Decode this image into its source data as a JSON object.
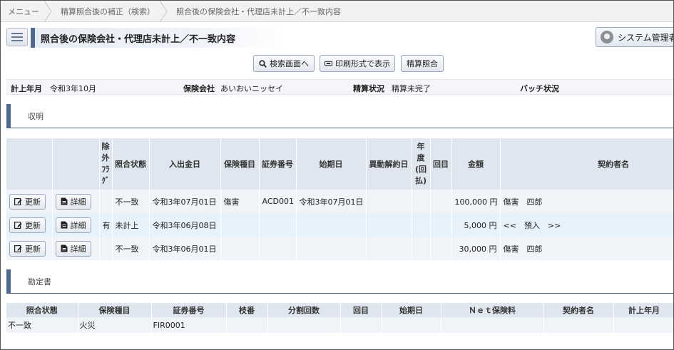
{
  "breadcrumb": [
    "メニュー",
    "精算照合後の補正（検索）",
    "照合後の保険会社・代理店未計上／不一致内容"
  ],
  "header": {
    "title": "照合後の保険会社・代理店未計上／不一致内容",
    "user_label": "システム管理者"
  },
  "toolbar": {
    "search_label": "検索画面へ",
    "print_label": "印刷形式で表示",
    "match_label": "精算照合"
  },
  "info": {
    "period_label": "計上年月",
    "period_value": "令和3年10月",
    "insurer_label": "保険会社",
    "insurer_value": "あいおいニッセイ",
    "status_label": "精算状況",
    "status_value": "精算未完了",
    "batch_label": "バッチ状況",
    "batch_value": ""
  },
  "sections": {
    "receipt": "収明",
    "account": "勘定書"
  },
  "main_table": {
    "headers": [
      "",
      "",
      "除外フラグ",
      "照合状態",
      "入出金日",
      "保険種目",
      "証券番号",
      "始期日",
      "異動解約日",
      "年度(回払)",
      "回目",
      "金額",
      "契約者名"
    ],
    "exclude_header_lines": [
      "除",
      "外",
      "ﾌﾗ",
      "ｸﾞ"
    ],
    "year_header_lines": [
      "年",
      "度",
      "(回",
      "払)"
    ],
    "update_label": "更新",
    "detail_label": "詳細",
    "rows": [
      {
        "exclude": "",
        "status": "不一致",
        "date": "令和3年07月01日",
        "type": "傷害",
        "policy": "ACD001",
        "start": "令和3年07月01日",
        "change": "",
        "year": "",
        "times": "",
        "amount": "100,000 円",
        "name": "傷害　四郎"
      },
      {
        "exclude": "有",
        "status": "未計上",
        "date": "令和3年06月08日",
        "type": "",
        "policy": "",
        "start": "",
        "change": "",
        "year": "",
        "times": "",
        "amount": "5,000 円",
        "name": "<<　預入　>>"
      },
      {
        "exclude": "",
        "status": "不一致",
        "date": "令和3年06月01日",
        "type": "",
        "policy": "",
        "start": "",
        "change": "",
        "year": "",
        "times": "",
        "amount": "30,000 円",
        "name": "傷害　四郎"
      }
    ]
  },
  "sub_table": {
    "headers": [
      "照合状態",
      "保険種目",
      "証券番号",
      "枝番",
      "分割回数",
      "回目",
      "始期日",
      "Ｎｅｔ保険料",
      "契約者名",
      "計上年月"
    ],
    "rows": [
      {
        "status": "不一致",
        "type": "火災",
        "policy": "FIR0001",
        "branch": "",
        "split": "",
        "times": "",
        "start": "",
        "net": "",
        "name": "",
        "period": ""
      }
    ]
  },
  "colors": {
    "accent": "#4d6a95",
    "header_bg": "#dfe6ef",
    "row_bg": "#f0f3f7",
    "row_alt_bg": "#e7f1fa"
  }
}
